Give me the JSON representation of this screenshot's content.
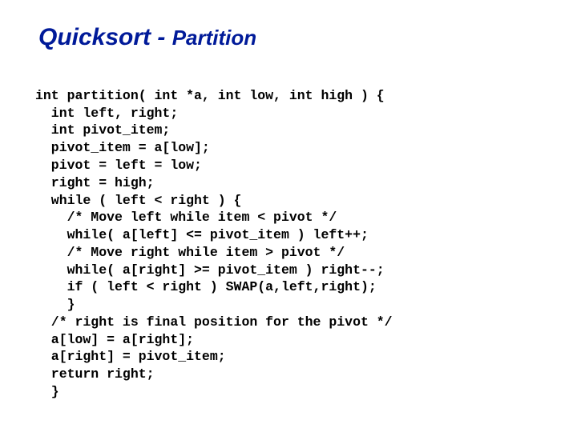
{
  "title": {
    "part1": "Quicksort - ",
    "part2": "Partition"
  },
  "code": {
    "l1": "int partition( int *a, int low, int high ) {",
    "l2": "  int left, right;",
    "l3": "  int pivot_item;",
    "l4": "  pivot_item = a[low];",
    "l5": "  pivot = left = low;",
    "l6": "  right = high;",
    "l7": "  while ( left < right ) {",
    "l8": "    /* Move left while item < pivot */",
    "l9": "    while( a[left] <= pivot_item ) left++;",
    "l10": "    /* Move right while item > pivot */",
    "l11": "    while( a[right] >= pivot_item ) right--;",
    "l12": "    if ( left < right ) SWAP(a,left,right);",
    "l13": "    }",
    "l14": "  /* right is final position for the pivot */",
    "l15": "  a[low] = a[right];",
    "l16": "  a[right] = pivot_item;",
    "l17": "  return right;",
    "l18": "  }"
  }
}
